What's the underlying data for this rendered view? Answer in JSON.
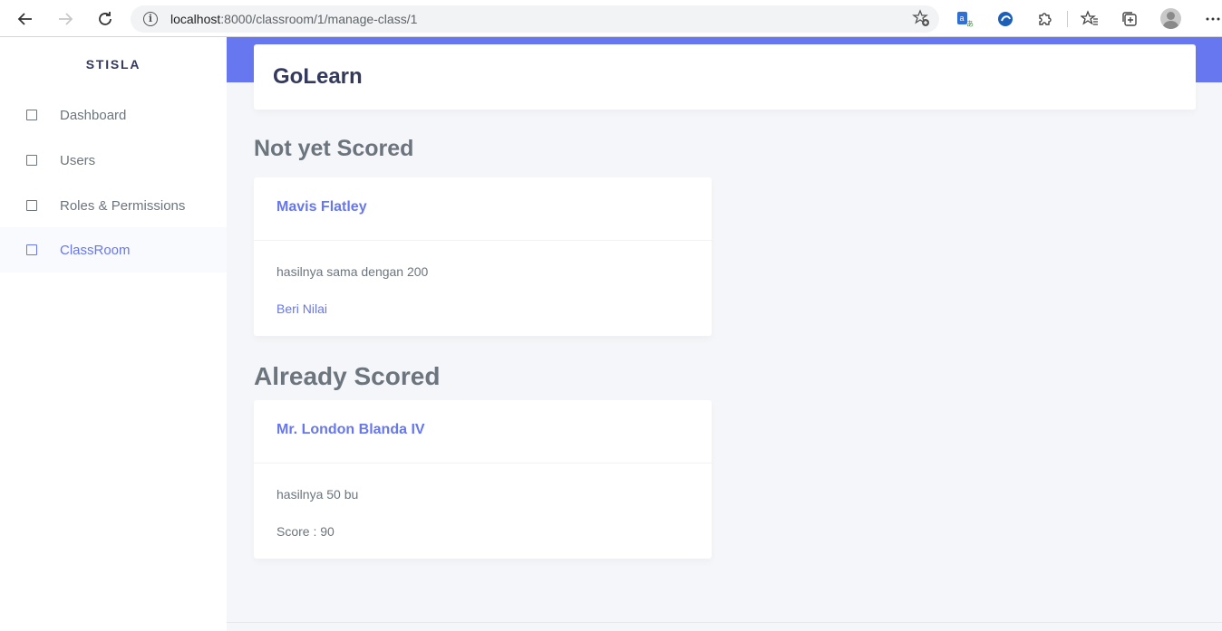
{
  "browser": {
    "url_host": "localhost",
    "url_rest": ":8000/classroom/1/manage-class/1"
  },
  "sidebar": {
    "brand": "STISLA",
    "items": [
      {
        "label": "Dashboard"
      },
      {
        "label": "Users"
      },
      {
        "label": "Roles & Permissions"
      },
      {
        "label": "ClassRoom"
      }
    ]
  },
  "header": {
    "title": "GoLearn"
  },
  "sections": {
    "not_scored": {
      "title": "Not yet Scored",
      "card": {
        "name": "Mavis Flatley",
        "answer": "hasilnya sama dengan 200",
        "action_label": "Beri Nilai"
      }
    },
    "scored": {
      "title": "Already Scored",
      "card": {
        "name": "Mr. London Blanda IV",
        "answer": "hasilnya 50 bu",
        "score_text": "Score : 90"
      }
    }
  },
  "colors": {
    "accent": "#6777ef",
    "background": "#f4f6f9",
    "text": "#6c757d",
    "heading": "#34395e"
  },
  "icons": [
    "back-icon",
    "forward-icon",
    "reload-icon",
    "info-icon",
    "add-favorite-icon",
    "translate-icon",
    "edge-extension-icon",
    "extensions-icon",
    "favorites-icon",
    "collections-icon",
    "profile-avatar",
    "more-icon",
    "menu-square-icon"
  ]
}
